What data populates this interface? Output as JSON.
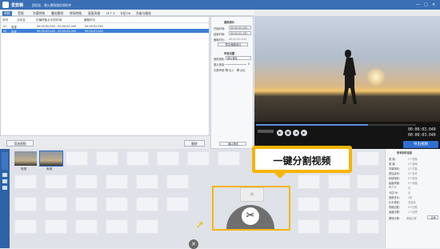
{
  "app": {
    "title": "爱剪辑",
    "subtitle": "超轻松、最火爆视频剪辑软件",
    "window_controls": [
      "—",
      "□",
      "✕"
    ]
  },
  "menu": {
    "items": [
      "视频",
      "音频",
      "字幕特效",
      "叠加素材",
      "转场特效",
      "画面风格",
      "M T V",
      "卡拉OK",
      "升级与服务"
    ],
    "active": 0
  },
  "list": {
    "columns": [
      "序号",
      "文件名",
      "在最终影片中的时间",
      "截取时长"
    ],
    "rows": [
      {
        "index": "01",
        "name": "电视",
        "range": "00:00:00.000 - 00:00:02.040",
        "duration": "00:00:02.040",
        "selected": false
      },
      {
        "index": "02",
        "name": "电视",
        "range": "00:00:02.040 - 00:00:03.040",
        "duration": "00:00:01.000",
        "selected": true
      }
    ],
    "add_button": "添加视频",
    "delete_button": "删除"
  },
  "properties": {
    "clip_header": "裁剪原片",
    "start_label": "开始时间:",
    "start_value": "00:00:00.000",
    "end_label": "结束时间:",
    "end_value": "00:00:02.040",
    "cut_duration_label": "截取时长:",
    "cut_duration_value": "00:00:02.040",
    "preview_button": "预览/截取原片",
    "audio_header": "声音设置",
    "track_label": "使用音轨:",
    "track_value": "原片音轨",
    "volume_label": "原片音量:",
    "volume_value": "0",
    "fade_label": "头尾声音:",
    "fade_in": "淡入",
    "fade_out": "淡出",
    "confirm_button": "确认修改"
  },
  "player": {
    "current_time": "00:00:03.040",
    "total_time": "00:00:03.040",
    "export_button": "导出视频",
    "progress": 0.7
  },
  "timeline": {
    "clips": [
      {
        "label": "电视"
      },
      {
        "label": "电视"
      }
    ],
    "add_label": "添加视频"
  },
  "callout": {
    "text": "一键分割视频",
    "color": "#f7b400"
  },
  "info_panel": {
    "title": "所有制作信息",
    "rows": [
      {
        "label": "视    频:",
        "value": "2个视频"
      },
      {
        "label": "音    频:",
        "value": "0个音频"
      },
      {
        "label": "字幕特效:",
        "value": "0个字幕"
      },
      {
        "label": "叠加素材:",
        "value": "0个素材"
      },
      {
        "label": "转场特效:",
        "value": "0个转场"
      },
      {
        "label": "画面风格:",
        "value": "0个风格"
      },
      {
        "label": "M T V:",
        "value": "无"
      },
      {
        "label": "卡拉OK:",
        "value": "无"
      },
      {
        "label": "视频总长:",
        "value": "3秒"
      },
      {
        "label": "片头特效:",
        "value": "未选择"
      },
      {
        "label": "视频边框:",
        "value": "0个边框"
      },
      {
        "label": "画面清理:",
        "value": "1个清理"
      }
    ],
    "footer_label": "黑场片尾:",
    "footer_value": "黑幕片尾",
    "footer_button": "选择"
  },
  "colors": {
    "accent": "#3a6fb5",
    "highlight": "#f7b400",
    "export": "#2f6fd0"
  }
}
